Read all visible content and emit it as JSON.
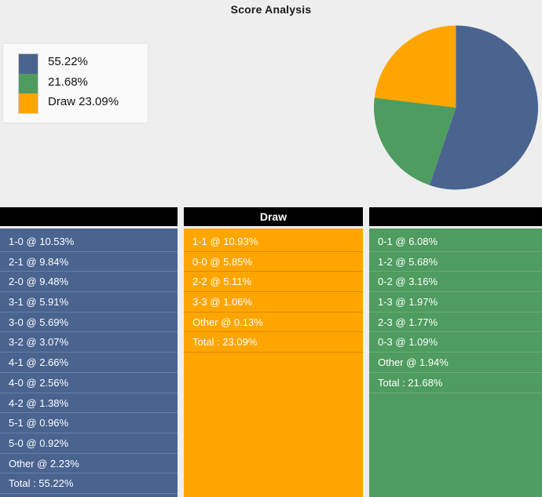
{
  "chart": {
    "title": "Score Analysis",
    "legend": [
      {
        "label": "55.22%",
        "color": "#4a6490",
        "swatch": "home-swatch"
      },
      {
        "label": "21.68%",
        "color": "#4e9c5f",
        "swatch": "away-swatch"
      },
      {
        "label": "Draw 23.09%",
        "color": "#ffa500",
        "swatch": "draw-swatch"
      }
    ]
  },
  "chart_data": {
    "type": "pie",
    "title": "Score Analysis",
    "labels": [
      "55.22%",
      "21.68%",
      "Draw 23.09%"
    ],
    "values": [
      55.22,
      21.68,
      23.09
    ],
    "colors": [
      "#4a6490",
      "#4e9c5f",
      "#ffa500"
    ],
    "start_angle": 90,
    "direction": "clockwise",
    "legend_position": "left",
    "grid": false,
    "slice_order": [
      "55.22%",
      "21.68%",
      "Draw 23.09%"
    ]
  },
  "columns": {
    "home": {
      "header": "",
      "color": "#4a6490",
      "rows": [
        "1-0 @ 10.53%",
        "2-1 @ 9.84%",
        "2-0 @ 9.48%",
        "3-1 @ 5.91%",
        "3-0 @ 5.69%",
        "3-2 @ 3.07%",
        "4-1 @ 2.66%",
        "4-0 @ 2.56%",
        "4-2 @ 1.38%",
        "5-1 @ 0.96%",
        "5-0 @ 0.92%",
        "Other @ 2.23%",
        "Total : 55.22%"
      ]
    },
    "draw": {
      "header": "Draw",
      "color": "#ffa500",
      "rows": [
        "1-1 @ 10.93%",
        "0-0 @ 5.85%",
        "2-2 @ 5.11%",
        "3-3 @ 1.06%",
        "Other @ 0.13%",
        "Total : 23.09%"
      ]
    },
    "away": {
      "header": "",
      "color": "#4e9c5f",
      "rows": [
        "0-1 @ 6.08%",
        "1-2 @ 5.68%",
        "0-2 @ 3.16%",
        "1-3 @ 1.97%",
        "2-3 @ 1.77%",
        "0-3 @ 1.09%",
        "Other @ 1.94%",
        "Total : 21.68%"
      ]
    }
  }
}
